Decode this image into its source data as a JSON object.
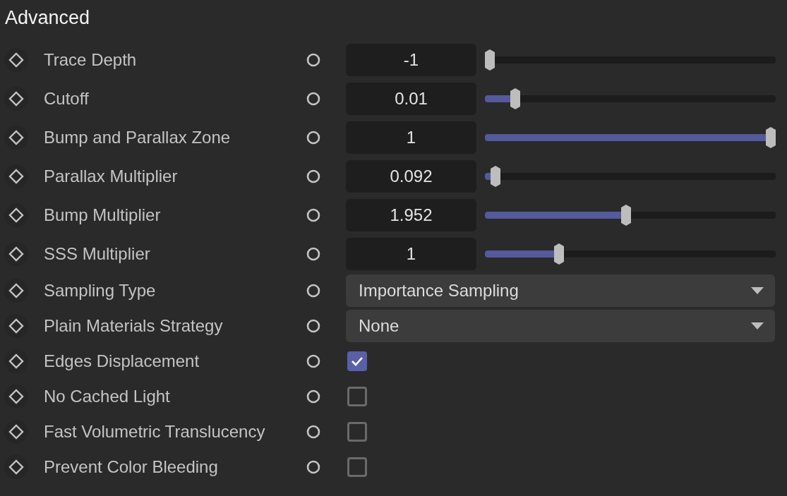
{
  "title": "Advanced",
  "rows": [
    {
      "kind": "slider",
      "label": "Trace Depth",
      "value": "-1",
      "level": 0
    },
    {
      "kind": "slider",
      "label": "Cutoff",
      "value": "0.01",
      "level": 0.09
    },
    {
      "kind": "slider",
      "label": "Bump and Parallax Zone",
      "value": "1",
      "level": 1
    },
    {
      "kind": "slider",
      "label": "Parallax Multiplier",
      "value": "0.092",
      "level": 0.02
    },
    {
      "kind": "slider",
      "label": "Bump Multiplier",
      "value": "1.952",
      "level": 0.485
    },
    {
      "kind": "slider",
      "label": "SSS Multiplier",
      "value": "1",
      "level": 0.245
    },
    {
      "kind": "dropdown",
      "label": "Sampling Type",
      "value": "Importance Sampling"
    },
    {
      "kind": "dropdown",
      "label": "Plain Materials Strategy",
      "value": "None"
    },
    {
      "kind": "checkbox",
      "label": "Edges Displacement",
      "checked": true
    },
    {
      "kind": "checkbox",
      "label": "No Cached Light",
      "checked": false
    },
    {
      "kind": "checkbox",
      "label": "Fast Volumetric Translucency",
      "checked": false
    },
    {
      "kind": "checkbox",
      "label": "Prevent Color Bleeding",
      "checked": false
    }
  ]
}
